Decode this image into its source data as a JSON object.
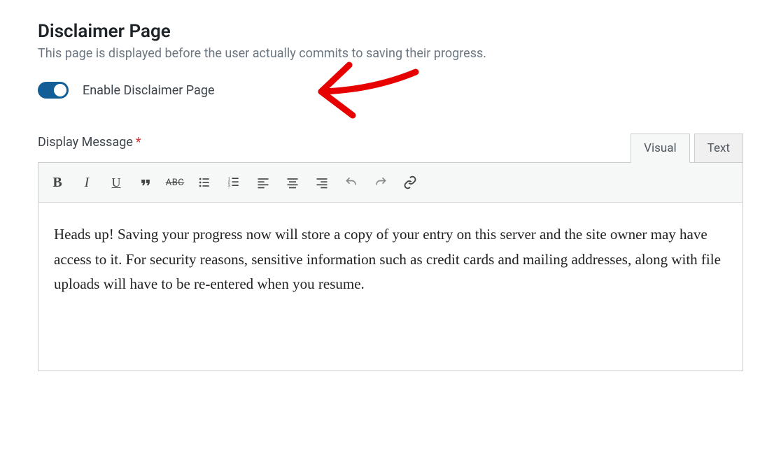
{
  "section": {
    "title": "Disclaimer Page",
    "desc": "This page is displayed before the user actually commits to saving their progress."
  },
  "toggle": {
    "label": "Enable Disclaimer Page",
    "on": true
  },
  "field": {
    "label": "Display Message",
    "required_mark": "*"
  },
  "tabs": {
    "visual": "Visual",
    "text": "Text",
    "active": "visual"
  },
  "editor": {
    "content": "Heads up! Saving your progress now will store a copy of your entry on this server and the site owner may have access to it. For security reasons, sensitive information such as credit cards and mailing addresses, along with file uploads will have to be re-entered when you resume."
  },
  "annotation": {
    "arrow_color": "#e60000"
  }
}
